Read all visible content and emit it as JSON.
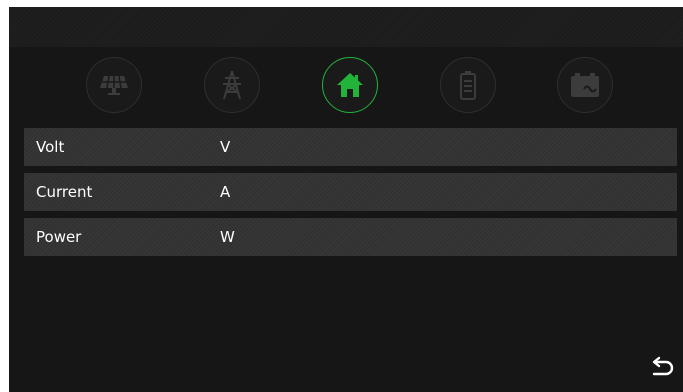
{
  "nav": {
    "items": [
      {
        "icon": "solar-panel-icon",
        "active": false
      },
      {
        "icon": "power-tower-icon",
        "active": false
      },
      {
        "icon": "home-icon",
        "active": true
      },
      {
        "icon": "battery-icon",
        "active": false
      },
      {
        "icon": "ac-load-icon",
        "active": false
      }
    ]
  },
  "rows": [
    {
      "label": "Volt",
      "value": "",
      "unit": "V"
    },
    {
      "label": "Current",
      "value": "",
      "unit": "A"
    },
    {
      "label": "Power",
      "value": "",
      "unit": "W"
    }
  ],
  "back": {
    "icon": "back-arrow-icon"
  },
  "colors": {
    "accent": "#22b33a",
    "background": "#161616",
    "row": "#333333",
    "icon": "#3c3c3c"
  }
}
